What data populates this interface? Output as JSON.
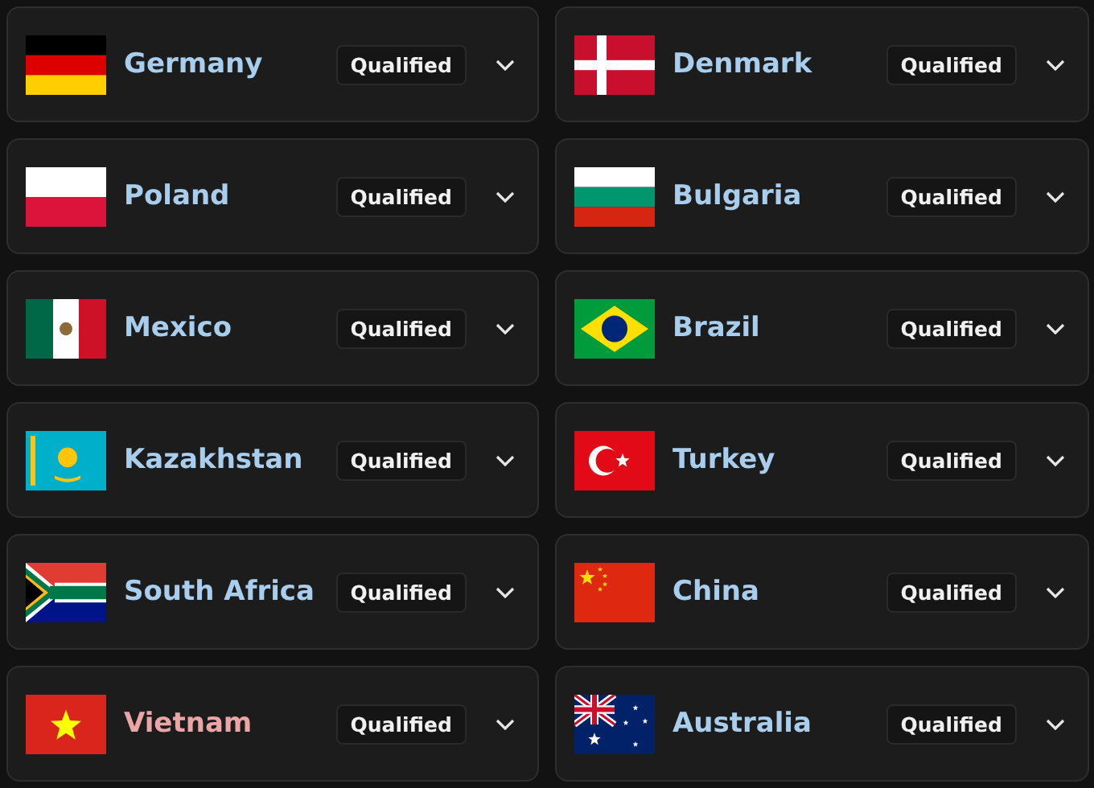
{
  "countries": [
    {
      "name": "Germany",
      "color": "#a9cdec",
      "status": "Qualified"
    },
    {
      "name": "Denmark",
      "color": "#a9cdec",
      "status": "Qualified"
    },
    {
      "name": "Poland",
      "color": "#a9cdec",
      "status": "Qualified"
    },
    {
      "name": "Bulgaria",
      "color": "#a9cdec",
      "status": "Qualified"
    },
    {
      "name": "Mexico",
      "color": "#a9cdec",
      "status": "Qualified"
    },
    {
      "name": "Brazil",
      "color": "#a9cdec",
      "status": "Qualified"
    },
    {
      "name": "Kazakhstan",
      "color": "#a9cdec",
      "status": "Qualified"
    },
    {
      "name": "Turkey",
      "color": "#a9cdec",
      "status": "Qualified"
    },
    {
      "name": "South Africa",
      "color": "#a9cdec",
      "status": "Qualified"
    },
    {
      "name": "China",
      "color": "#a9cdec",
      "status": "Qualified"
    },
    {
      "name": "Vietnam",
      "color": "#eaa6a6",
      "status": "Qualified"
    },
    {
      "name": "Australia",
      "color": "#a9cdec",
      "status": "Qualified"
    }
  ]
}
